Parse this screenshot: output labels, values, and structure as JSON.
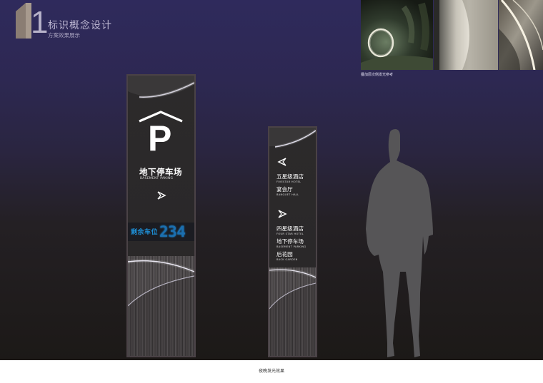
{
  "header": {
    "section_number": "1",
    "title": "标识概念设计",
    "subtitle": "方案效果展示"
  },
  "reference": {
    "caption": "叠加层次侧发光参考"
  },
  "parking_sign": {
    "letter": "P",
    "title_cn": "地下停车场",
    "title_en": "BASEMENT PAKING",
    "remaining_label": "剩余车位",
    "remaining_count": "234"
  },
  "direction_sign": {
    "groups": [
      {
        "items": [
          {
            "cn": "五星级酒店",
            "en": "FIVESTAR HOTEL"
          },
          {
            "cn": "宴会厅",
            "en": "BANQUET HALL"
          }
        ]
      },
      {
        "items": [
          {
            "cn": "四星级酒店",
            "en": "FOUR STAR HOTEL"
          },
          {
            "cn": "地下停车场",
            "en": "BASEMENT PARKING"
          },
          {
            "cn": "后花园",
            "en": "BACK GARDEN"
          }
        ]
      }
    ]
  },
  "footer": {
    "caption": "夜晚发光效果"
  }
}
